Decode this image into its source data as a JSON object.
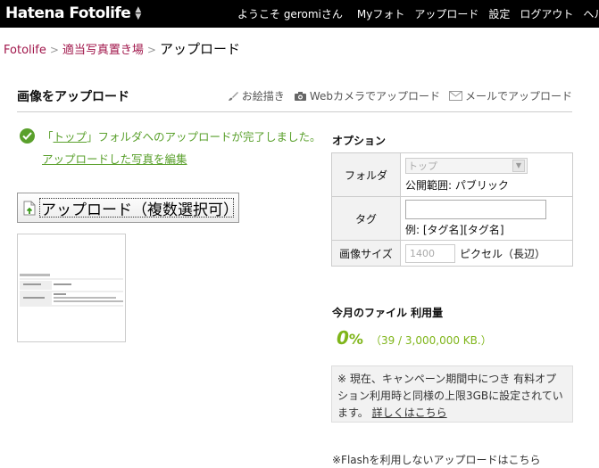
{
  "header": {
    "logo_text": "Hatena Fotolife",
    "greeting": "ようこそ geromiさん",
    "nav": [
      "Myフォト",
      "アップロード",
      "設定",
      "ログアウト",
      "ヘルプ"
    ]
  },
  "breadcrumb": {
    "items": [
      "Fotolife",
      "適当写真置き場"
    ],
    "separator": ">",
    "current": "アップロード"
  },
  "upload_section": {
    "heading": "画像をアップロード",
    "links": {
      "draw": "お絵描き",
      "webcam": "Webカメラでアップロード",
      "mail": "メールでアップロード"
    }
  },
  "success": {
    "prefix": "「",
    "folder_link": "トップ",
    "suffix": "」フォルダへのアップロードが完了しました。",
    "edit_link": "アップロードした写真を編集"
  },
  "upload_button": {
    "label": "アップロード（複数選択可）"
  },
  "options": {
    "title": "オプション",
    "folder_label": "フォルダ",
    "folder_value": "トップ",
    "visibility": "公開範囲: パブリック",
    "tag_label": "タグ",
    "tag_value": "",
    "tag_example": "例: [タグ名][タグ名]",
    "size_label": "画像サイズ",
    "size_value": "1400",
    "size_unit": "ピクセル（長辺）"
  },
  "usage": {
    "title": "今月のファイル 利用量",
    "percent": "0",
    "percent_sign": "%",
    "detail": "（39 / 3,000,000 KB.）"
  },
  "notice": {
    "text": "※ 現在、キャンペーン期間中につき 有料オプション利用時と同様の上限3GBに設定されています。",
    "link": "詳しくはこちら"
  },
  "flash_note": "※Flashを利用しないアップロードはこちら",
  "icons": {
    "success": "check-circle-icon",
    "draw": "brush-icon",
    "webcam": "camera-icon",
    "mail": "envelope-icon",
    "upload": "upload-file-icon"
  },
  "colors": {
    "topbar": "#000000",
    "breadcrumb_link": "#a0154a",
    "success": "#5aa02c",
    "usage": "#7fb51a"
  }
}
